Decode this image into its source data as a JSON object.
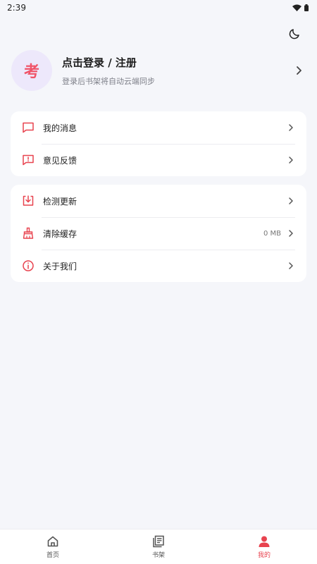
{
  "status_bar": {
    "time": "2:39"
  },
  "profile": {
    "avatar_char": "考",
    "title": "点击登录 / 注册",
    "subtitle": "登录后书架将自动云端同步"
  },
  "menu_group_1": [
    {
      "label": "我的消息",
      "icon": "message-icon"
    },
    {
      "label": "意见反馈",
      "icon": "feedback-icon"
    }
  ],
  "menu_group_2": [
    {
      "label": "检测更新",
      "icon": "update-icon"
    },
    {
      "label": "清除缓存",
      "icon": "broom-icon",
      "value": "0 MB"
    },
    {
      "label": "关于我们",
      "icon": "info-icon"
    }
  ],
  "tabs": [
    {
      "label": "首页",
      "icon": "home-icon",
      "active": false
    },
    {
      "label": "书架",
      "icon": "bookshelf-icon",
      "active": false
    },
    {
      "label": "我的",
      "icon": "user-icon",
      "active": true
    }
  ],
  "colors": {
    "accent": "#e8434f",
    "avatar_bg": "#ede8fb",
    "background": "#f5f6fa"
  }
}
